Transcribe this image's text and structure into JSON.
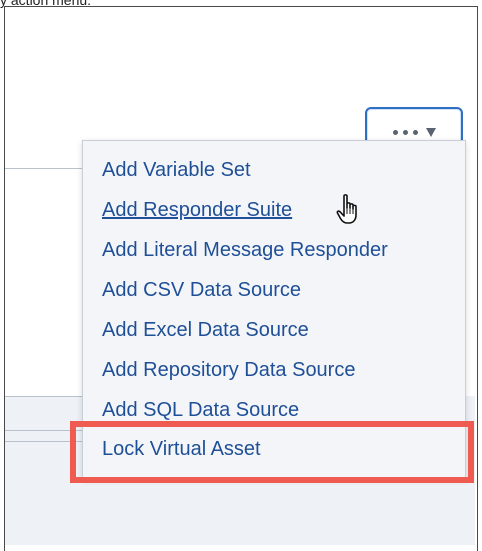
{
  "caption": "y action menu.",
  "menu_button": {
    "icon": "more-actions-icon",
    "caret_icon": "caret-down-icon"
  },
  "menu": {
    "items": [
      {
        "label": "Add Variable Set"
      },
      {
        "label": "Add Responder Suite"
      },
      {
        "label": "Add Literal Message Responder"
      },
      {
        "label": "Add CSV Data Source"
      },
      {
        "label": "Add Excel Data Source"
      },
      {
        "label": "Add Repository Data Source"
      },
      {
        "label": "Add SQL Data Source"
      },
      {
        "label": "Lock Virtual Asset"
      }
    ],
    "hovered_index": 1,
    "highlighted_index": 7
  },
  "colors": {
    "link": "#1f4f96",
    "button_border": "#2f70c4",
    "highlight": "#ef5b50",
    "menu_bg": "#f3f5f9"
  }
}
